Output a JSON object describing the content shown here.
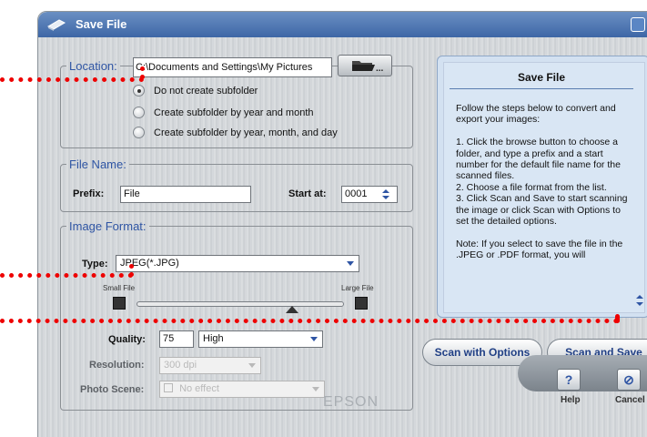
{
  "window": {
    "title": "Save File"
  },
  "location": {
    "legend": "Location:",
    "path": "C:\\Documents and Settings\\My Pictures",
    "browse_label": "...",
    "options": [
      "Do not create subfolder",
      "Create subfolder by year and month",
      "Create subfolder by year, month, and day"
    ],
    "selected_index": 0
  },
  "file_name": {
    "legend": "File Name:",
    "prefix_label": "Prefix:",
    "prefix_value": "File",
    "start_label": "Start at:",
    "start_value": "0001"
  },
  "image_format": {
    "legend": "Image Format:",
    "type_label": "Type:",
    "type_value": "JPEG(*.JPG)",
    "small_file_label": "Small File",
    "large_file_label": "Large File",
    "quality_label": "Quality:",
    "quality_value": "75",
    "quality_level": "High",
    "quality_slider_fraction": 0.75,
    "resolution_label": "Resolution:",
    "resolution_value": "300 dpi",
    "photo_scene_label": "Photo Scene:",
    "photo_scene_value": "No effect"
  },
  "help_panel": {
    "title": "Save File",
    "body": "Follow the steps below to convert and export your images:\n\n1. Click the browse button to choose a folder, and type a prefix and a start number for the default file name for the scanned files.\n2. Choose a file format from the list.\n3. Click Scan and Save to start scanning the image or click Scan with Options to set the detailed options.\n\nNote: If you select to save the file in the .JPEG or .PDF format, you will"
  },
  "actions": {
    "scan_with_options": "Scan with Options",
    "scan_and_save": "Scan and Save"
  },
  "bottom": {
    "help_label": "Help",
    "help_symbol": "?",
    "cancel_label": "Cancel",
    "cancel_symbol": "⊘",
    "brand": "EPSON"
  },
  "colors": {
    "title_bar": "#4a72b0",
    "legend": "#2f55a4",
    "annotation": "#ee0000",
    "help_panel_bg": "#d9e6f4"
  }
}
